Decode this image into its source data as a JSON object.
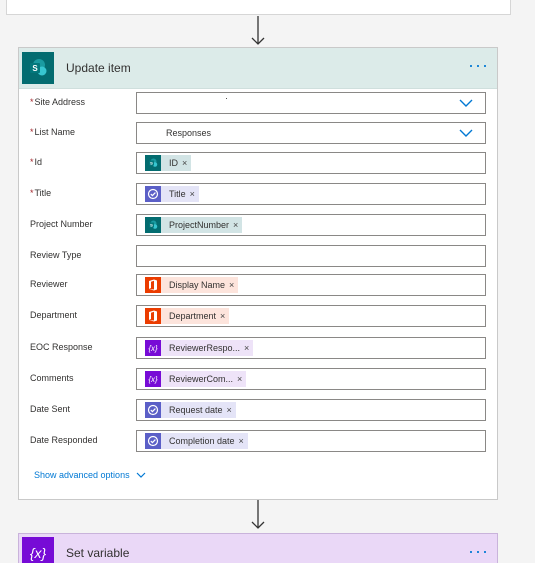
{
  "update_card": {
    "title": "Update item",
    "more_label": "···"
  },
  "fields": [
    {
      "label": "Site Address",
      "required": true,
      "type": "dropdown",
      "value": "·"
    },
    {
      "label": "List Name",
      "required": true,
      "type": "dropdown",
      "value": "Responses"
    },
    {
      "label": "Id",
      "required": true,
      "type": "token",
      "token": {
        "label": "ID",
        "source": "sharepoint"
      }
    },
    {
      "label": "Title",
      "required": true,
      "type": "token",
      "token": {
        "label": "Title",
        "source": "flow"
      }
    },
    {
      "label": "Project Number",
      "required": false,
      "type": "token",
      "token": {
        "label": "ProjectNumber",
        "source": "sharepoint"
      }
    },
    {
      "label": "Review Type",
      "required": false,
      "type": "empty"
    },
    {
      "label": "Reviewer",
      "required": false,
      "type": "token",
      "token": {
        "label": "Display Name",
        "source": "office"
      }
    },
    {
      "label": "Department",
      "required": false,
      "type": "token",
      "token": {
        "label": "Department",
        "source": "office"
      }
    },
    {
      "label": "EOC Response",
      "required": false,
      "type": "token",
      "token": {
        "label": "ReviewerRespo...",
        "source": "variable"
      }
    },
    {
      "label": "Comments",
      "required": false,
      "type": "token",
      "token": {
        "label": "ReviewerCom...",
        "source": "variable"
      }
    },
    {
      "label": "Date Sent",
      "required": false,
      "type": "token",
      "token": {
        "label": "Request date",
        "source": "flow"
      }
    },
    {
      "label": "Date Responded",
      "required": false,
      "type": "token",
      "token": {
        "label": "Completion date",
        "source": "flow"
      }
    }
  ],
  "required_marker": "*",
  "token_remove": "×",
  "advanced_options_label": "Show advanced options",
  "var_card": {
    "title": "Set variable",
    "icon_text": "{x}",
    "more_label": "···"
  },
  "colors": {
    "accent": "#0078d4",
    "sharepoint": "#036c70",
    "flow": "#5b5fc7",
    "office": "#eb3c00",
    "variable": "#770bd6",
    "required": "#a4262c"
  },
  "icons": {
    "sharepoint": "sharepoint-icon",
    "flow": "approvals-icon",
    "office": "office-icon",
    "variable": "variable-icon"
  }
}
